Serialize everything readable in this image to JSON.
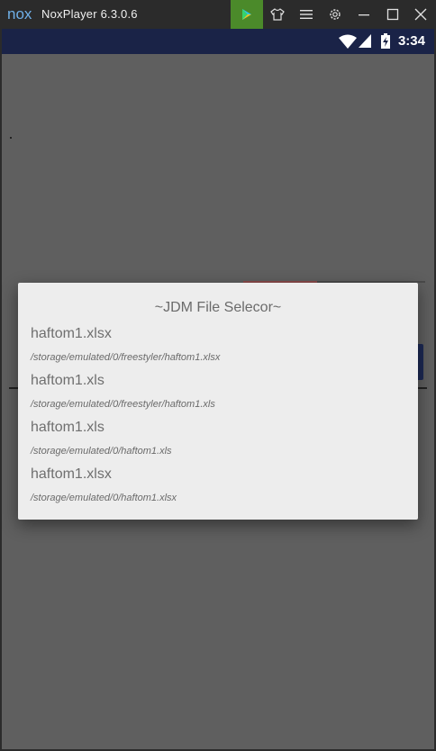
{
  "window": {
    "logo_text": "nox",
    "title": "NoxPlayer 6.3.0.6"
  },
  "toolbar": {
    "buttons": [
      "play-store-icon",
      "shirt-icon",
      "menu-icon",
      "gear-icon",
      "minimize-icon",
      "maximize-icon",
      "close-icon"
    ]
  },
  "status_bar": {
    "time": "3:34"
  },
  "dialog": {
    "title": "~JDM File Selecor~",
    "files": [
      {
        "name": "haftom1.xlsx",
        "path": "/storage/emulated/0/freestyler/haftom1.xlsx"
      },
      {
        "name": "haftom1.xls",
        "path": "/storage/emulated/0/freestyler/haftom1.xls"
      },
      {
        "name": "haftom1.xls",
        "path": "/storage/emulated/0/haftom1.xls"
      },
      {
        "name": "haftom1.xlsx",
        "path": "/storage/emulated/0/haftom1.xlsx"
      }
    ]
  }
}
